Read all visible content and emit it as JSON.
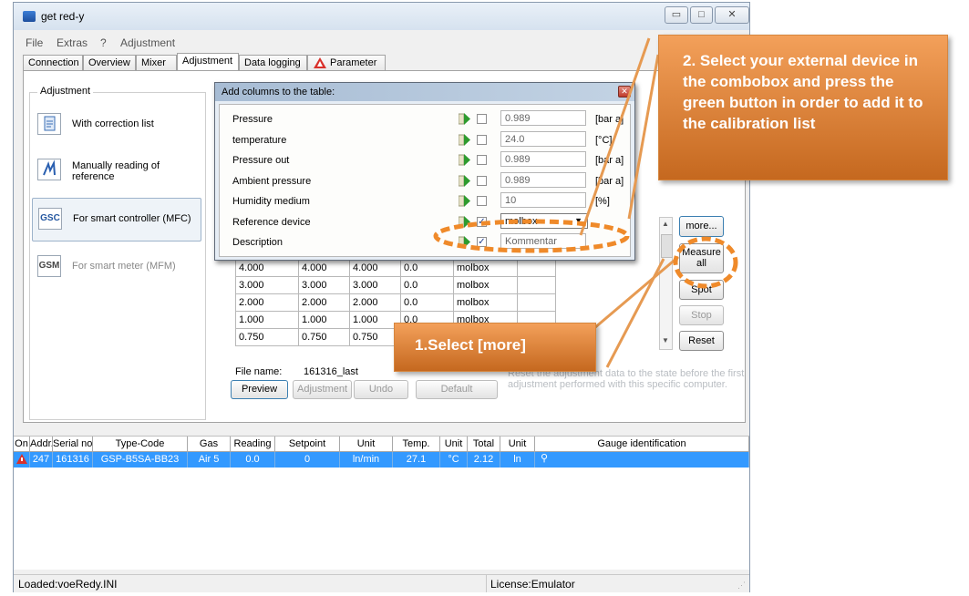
{
  "window": {
    "title": "get red-y",
    "controls": {
      "minimize": "▭",
      "maximize": "□",
      "close": "✕"
    }
  },
  "menu": [
    "File",
    "Extras",
    "?",
    "Adjustment"
  ],
  "tabs": [
    "Connection",
    "Overview",
    "Mixer",
    "Adjustment",
    "Data logging",
    "Parameter"
  ],
  "active_tab": "Adjustment",
  "adjustment": {
    "title": "Adjustment",
    "items": [
      {
        "label": "With correction list",
        "icon": "correction-list-icon",
        "icon_text": ""
      },
      {
        "label": "Manually reading of reference",
        "icon": "manual-reading-icon",
        "icon_text": ""
      },
      {
        "label": "For smart controller (MFC)",
        "icon": "gsc-icon",
        "icon_text": "GSC"
      },
      {
        "label": "For smart meter (MFM)",
        "icon": "gsm-icon",
        "icon_text": "GSM"
      }
    ]
  },
  "dialog": {
    "title": "Add columns to the table:",
    "rows": [
      {
        "label": "Pressure",
        "checked": false,
        "value": "0.989",
        "unit": "[bar a]"
      },
      {
        "label": "temperature",
        "checked": false,
        "value": "24.0",
        "unit": "[°C]"
      },
      {
        "label": "Pressure out",
        "checked": false,
        "value": "0.989",
        "unit": "[bar a]"
      },
      {
        "label": "Ambient pressure",
        "checked": false,
        "value": "0.989",
        "unit": "[bar a]"
      },
      {
        "label": "Humidity medium",
        "checked": false,
        "value": "10",
        "unit": "[%]"
      },
      {
        "label": "Reference device",
        "checked": true,
        "value": "molbox",
        "unit": ""
      },
      {
        "label": "Description",
        "checked": true,
        "value": "Kommentar",
        "unit": ""
      }
    ]
  },
  "table": {
    "rows": [
      [
        "4.000",
        "4.000",
        "4.000",
        "0.0",
        "molbox"
      ],
      [
        "3.000",
        "3.000",
        "3.000",
        "0.0",
        "molbox"
      ],
      [
        "2.000",
        "2.000",
        "2.000",
        "0.0",
        "molbox"
      ],
      [
        "1.000",
        "1.000",
        "1.000",
        "0.0",
        "molbox"
      ],
      [
        "0.750",
        "0.750",
        "0.750",
        "",
        ""
      ]
    ]
  },
  "side_buttons": {
    "more": "more...",
    "measure_all": "Measure all",
    "spot": "Spot",
    "stop": "Stop",
    "reset": "Reset"
  },
  "file": {
    "label": "File name:",
    "name": "161316_last"
  },
  "bottom_buttons": {
    "preview": "Preview",
    "adjustment": "Adjustment",
    "undo": "Undo",
    "default": "Default"
  },
  "hint": "Reset the adjustment data to the state before the first adjustment performed with this specific computer.",
  "grid": {
    "headers": [
      "On",
      "Addr.",
      "Serial no.",
      "Type-Code",
      "Gas",
      "Reading",
      "Setpoint",
      "Unit",
      "Temp.",
      "Unit",
      "Total",
      "Unit",
      "Gauge identification"
    ],
    "row": [
      "",
      "247",
      "161316",
      "GSP-B5SA-BB23",
      "Air 5",
      "0.0",
      "0",
      "ln/min",
      "27.1",
      "°C",
      "2.12",
      "ln",
      ""
    ]
  },
  "status": {
    "left": "Loaded:voeRedy.INI",
    "right": "License:Emulator"
  },
  "callouts": {
    "step2": "2. Select your external device in the combobox and press the green button in order to add it to the calibration list",
    "step1": "1.Select [more]"
  },
  "colors": {
    "highlight": "#3399ff",
    "callout": "#e07f2f",
    "selection_dash": "#ef8a2a",
    "add_button": "#2e9b2e"
  }
}
